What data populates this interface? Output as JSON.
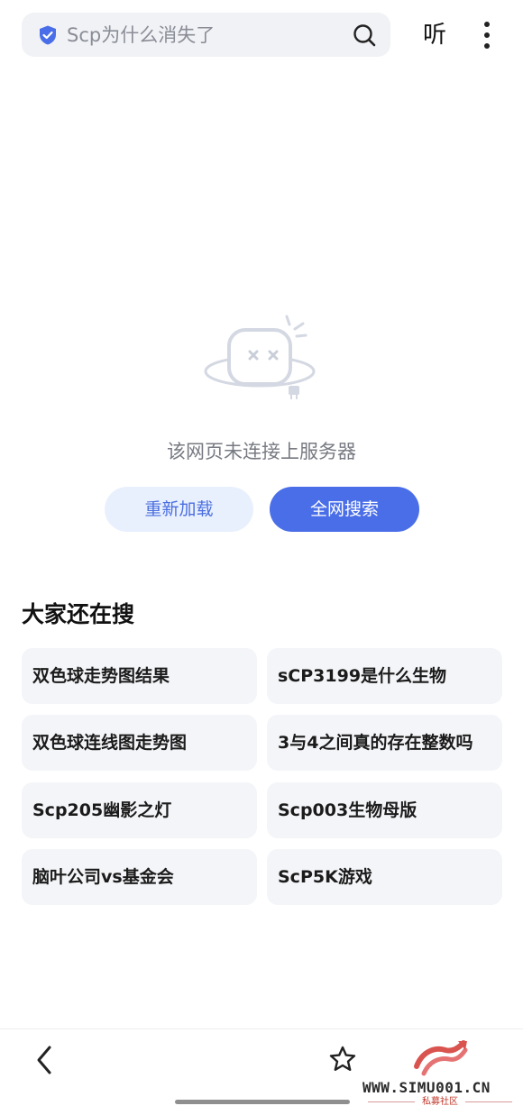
{
  "search": {
    "query": "Scp为什么消失了"
  },
  "toolbar": {
    "listen_label": "听"
  },
  "error": {
    "message": "该网页未连接上服务器",
    "reload_label": "重新加载",
    "search_all_label": "全网搜索"
  },
  "suggestions": {
    "title": "大家还在搜",
    "items": [
      "双色球走势图结果",
      "sCP3199是什么生物",
      "双色球连线图走势图",
      "3与4之间真的存在整数吗",
      "Scp205幽影之灯",
      "Scp003生物母版",
      "脑叶公司vs基金会",
      "ScP5K游戏"
    ]
  },
  "watermark": {
    "url": "WWW.SIMU001.CN",
    "subtitle": "私募社区"
  },
  "colors": {
    "accent": "#4a6ee8",
    "reload_bg": "#e9f0fd",
    "card_bg": "#f4f5f8",
    "search_bg": "#f1f2f6"
  },
  "icons": {
    "shield": "shield-check-icon",
    "search": "search-icon",
    "more": "more-vertical-icon",
    "back": "chevron-left-icon",
    "bookmark": "star-icon",
    "error": "disconnected-plug-icon"
  }
}
